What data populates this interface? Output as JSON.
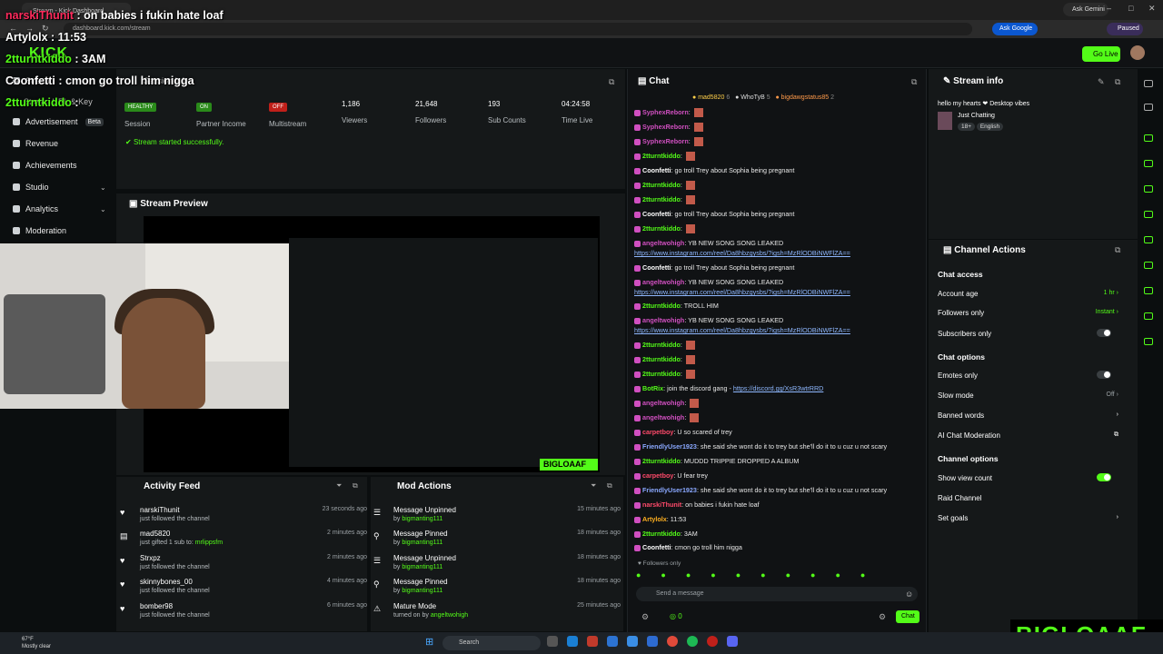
{
  "browser": {
    "tab_title": "Stream - Kick Dashboard",
    "url": "dashboard.kick.com/stream",
    "ask_gemini": "Ask Gemini",
    "ask_google": "Ask Google",
    "profile_status": "Paused"
  },
  "header": {
    "logo": "KICK",
    "go_live": "Go Live"
  },
  "sidebar": {
    "items": [
      {
        "label": "Stream"
      },
      {
        "label": "Session Info"
      },
      {
        "label": "Stream URL & Key"
      },
      {
        "label": "Advertisement",
        "badge": "Beta"
      },
      {
        "label": "Revenue"
      },
      {
        "label": "Achievements"
      },
      {
        "label": "Studio"
      },
      {
        "label": "Analytics"
      },
      {
        "label": "Moderation"
      }
    ]
  },
  "stats": {
    "items": [
      {
        "badge": "HEALTHY",
        "label": "Session"
      },
      {
        "badge": "ON",
        "label": "Partner Income"
      },
      {
        "badge": "OFF",
        "label": "Multistream"
      },
      {
        "value": "1,186",
        "label": "Viewers"
      },
      {
        "value": "21,648",
        "label": "Followers"
      },
      {
        "value": "193",
        "label": "Sub Counts"
      },
      {
        "value": "04:24:58",
        "label": "Time Live"
      }
    ],
    "status_message": "Stream started successfully."
  },
  "preview": {
    "title": "Stream Preview",
    "watermark": "BIGLOAAF"
  },
  "activity_feed": {
    "title": "Activity Feed",
    "items": [
      {
        "name": "narskiThunit",
        "detail": "just followed the channel",
        "time": "23 seconds ago"
      },
      {
        "name": "mad5820",
        "detail": "just gifted 1 sub to:",
        "target": "mrlippsfm",
        "time": "2 minutes ago"
      },
      {
        "name": "Strxpz",
        "detail": "just followed the channel",
        "time": "2 minutes ago"
      },
      {
        "name": "skinnybones_00",
        "detail": "just followed the channel",
        "time": "4 minutes ago"
      },
      {
        "name": "bomber98",
        "detail": "just followed the channel",
        "time": "6 minutes ago"
      }
    ]
  },
  "mod_actions": {
    "title": "Mod Actions",
    "items": [
      {
        "action": "Message Unpinned",
        "by": "by",
        "mod": "bigmanting111",
        "time": "15 minutes ago"
      },
      {
        "action": "Message Pinned",
        "by": "by",
        "mod": "bigmanting111",
        "time": "18 minutes ago"
      },
      {
        "action": "Message Unpinned",
        "by": "by",
        "mod": "bigmanting111",
        "time": "18 minutes ago"
      },
      {
        "action": "Message Pinned",
        "by": "by",
        "mod": "bigmanting111",
        "time": "18 minutes ago"
      },
      {
        "action": "Mature Mode",
        "by": "turned on by",
        "mod": "angeltwohigh",
        "time": "25 minutes ago"
      }
    ]
  },
  "chat": {
    "title": "Chat",
    "top_gifters": [
      {
        "name": "mad5820",
        "count": "6"
      },
      {
        "name": "WhoTyB",
        "count": "5"
      },
      {
        "name": "bigdawgstatus85",
        "count": "2"
      }
    ],
    "messages": [
      {
        "user": "SyphexReborn",
        "color": "#d04fc0",
        "text": "",
        "emote": true
      },
      {
        "user": "SyphexReborn",
        "color": "#d04fc0",
        "text": "",
        "emote": true
      },
      {
        "user": "SyphexReborn",
        "color": "#d04fc0",
        "text": "",
        "emote": true
      },
      {
        "user": "2tturntkiddo",
        "color": "#53fc18",
        "text": "",
        "emote": true
      },
      {
        "user": "Coonfetti",
        "color": "#ffffff",
        "text": "go troll Trey about Sophia being pregnant"
      },
      {
        "user": "2tturntkiddo",
        "color": "#53fc18",
        "text": "",
        "emote": true
      },
      {
        "user": "2tturntkiddo",
        "color": "#53fc18",
        "text": "",
        "emote": true
      },
      {
        "user": "Coonfetti",
        "color": "#ffffff",
        "text": "go troll Trey about Sophia being pregnant"
      },
      {
        "user": "2tturntkiddo",
        "color": "#53fc18",
        "text": "",
        "emote": true
      },
      {
        "user": "angeltwohigh",
        "color": "#d04fc0",
        "text": "YB NEW SONG SONG LEAKED"
      },
      {
        "user": "",
        "color": "#8fb8ff",
        "text": "https://www.instagram.com/reel/Da8hbzgysbs/?igsh=MzRlODBiNWFlZA==",
        "link": true
      },
      {
        "user": "Coonfetti",
        "color": "#ffffff",
        "text": "go troll Trey about Sophia being pregnant"
      },
      {
        "user": "angeltwohigh",
        "color": "#d04fc0",
        "text": "YB NEW SONG SONG LEAKED"
      },
      {
        "user": "",
        "color": "#8fb8ff",
        "text": "https://www.instagram.com/reel/Da8hbzgysbs/?igsh=MzRlODBiNWFlZA==",
        "link": true
      },
      {
        "user": "2tturntkiddo",
        "color": "#53fc18",
        "text": "TROLL HIM"
      },
      {
        "user": "angeltwohigh",
        "color": "#d04fc0",
        "text": "YB NEW SONG SONG LEAKED"
      },
      {
        "user": "",
        "color": "#8fb8ff",
        "text": "https://www.instagram.com/reel/Da8hbzgysbs/?igsh=MzRlODBiNWFlZA==",
        "link": true
      },
      {
        "user": "2tturntkiddo",
        "color": "#53fc18",
        "text": "",
        "emote": true
      },
      {
        "user": "2tturntkiddo",
        "color": "#53fc18",
        "text": "",
        "emote": true
      },
      {
        "user": "2tturntkiddo",
        "color": "#53fc18",
        "text": "",
        "emote": true
      },
      {
        "user": "BotRix",
        "color": "#53fc18",
        "text": "join the discord gang - ",
        "linktext": "https://discord.gg/XsR3wtrRRD"
      },
      {
        "user": "angeltwohigh",
        "color": "#d04fc0",
        "text": "",
        "emote": true
      },
      {
        "user": "angeltwohigh",
        "color": "#d04fc0",
        "text": "",
        "emote": true
      },
      {
        "user": "carpetboy",
        "color": "#ff4a6a",
        "text": "U so scared of trey"
      },
      {
        "user": "FriendlyUser1923",
        "color": "#8aa8ff",
        "text": "she said she wont do it to trey but she'll do it to u cuz u not scary"
      },
      {
        "user": "2tturntkiddo",
        "color": "#53fc18",
        "text": "MUDDD TRIPPIE DROPPED A ALBUM"
      },
      {
        "user": "carpetboy",
        "color": "#ff4a6a",
        "text": "U fear trey"
      },
      {
        "user": "FriendlyUser1923",
        "color": "#8aa8ff",
        "text": "she said she wont do it to trey but she'll do it to u cuz u not scary"
      },
      {
        "user": "narskiThunit",
        "color": "#ff4a6a",
        "text": "on babies i fukin hate loaf"
      },
      {
        "user": "Artylolx",
        "color": "#ffb020",
        "text": "11:53"
      },
      {
        "user": "2tturntkiddo",
        "color": "#53fc18",
        "text": "3AM"
      },
      {
        "user": "Coonfetti",
        "color": "#ffffff",
        "text": "cmon go troll him nigga"
      }
    ],
    "followers_only_note": "Followers only",
    "input_placeholder": "Send a message",
    "points": "0",
    "send_label": "Chat"
  },
  "stream_info": {
    "title": "Stream info",
    "stream_title": "hello my hearts ❤ Desktop vibes",
    "category": "Just Chatting",
    "tags": [
      "18+",
      "English"
    ]
  },
  "channel_actions": {
    "title": "Channel Actions",
    "chat_access_title": "Chat access",
    "account_age": {
      "label": "Account age",
      "value": "1 hr"
    },
    "followers_only": {
      "label": "Followers only",
      "value": "Instant"
    },
    "subscribers_only": {
      "label": "Subscribers only",
      "on": false
    },
    "chat_options_title": "Chat options",
    "emotes_only": {
      "label": "Emotes only",
      "on": false
    },
    "slow_mode": {
      "label": "Slow mode",
      "value": "Off"
    },
    "banned_words": {
      "label": "Banned words"
    },
    "ai_moderation": {
      "label": "AI Chat Moderation"
    },
    "channel_options_title": "Channel options",
    "show_view_count": {
      "label": "Show view count",
      "on": true
    },
    "raid_channel": {
      "label": "Raid Channel"
    },
    "set_goals": {
      "label": "Set goals"
    }
  },
  "overlay": {
    "lines": [
      {
        "name": "narskiThunit",
        "text": " : on babies i fukin hate loaf",
        "color": "#ff2a5c"
      },
      {
        "name": "Artylolx",
        "text": " : 11:53",
        "color": "#ffffff"
      },
      {
        "name": "2tturntkiddo",
        "text": " : 3AM",
        "color": "#53fc18"
      },
      {
        "name": "Coonfetti",
        "text": " : cmon go troll him nigga",
        "color": "#ffffff"
      },
      {
        "name": "2tturntkiddo",
        "text": " : ",
        "color": "#53fc18"
      }
    ],
    "brand": "BIGLOAAF"
  },
  "taskbar": {
    "weather_temp": "67°F",
    "weather_desc": "Mostly clear",
    "search_placeholder": "Search"
  }
}
